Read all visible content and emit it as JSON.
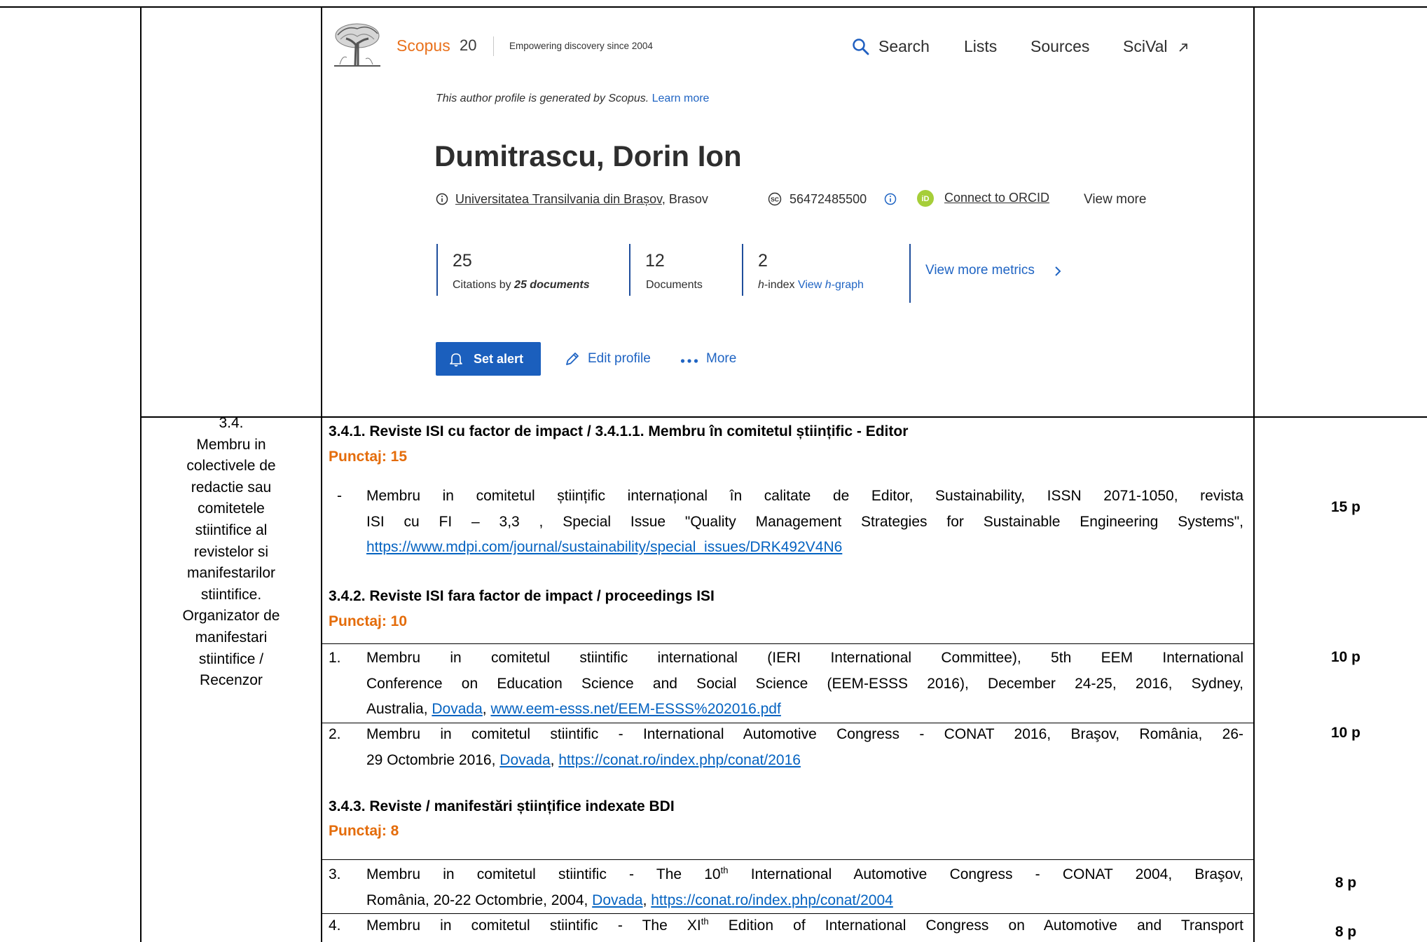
{
  "scopus": {
    "brand": "Scopus",
    "brand_number": "20",
    "tagline": "Empowering discovery since 2004",
    "nav": {
      "search": "Search",
      "lists": "Lists",
      "sources": "Sources",
      "scival": "SciVal"
    },
    "notice": {
      "text": "This author profile is generated by Scopus. ",
      "link": "Learn more"
    },
    "author": {
      "name": "Dumitrascu, Dorin Ion",
      "affiliation": "Universitatea Transilvania din Brașov",
      "city": ", Brasov",
      "author_id": "56472485500",
      "orcid": "Connect to ORCID",
      "view_more": "View more"
    },
    "metrics": {
      "citations": {
        "value": "25",
        "label": "Citations by ",
        "label_emph": "25 documents"
      },
      "documents": {
        "value": "12",
        "label": "Documents"
      },
      "h_index": {
        "value": "2",
        "label_h": "h",
        "label": "-index ",
        "link_prefix": "View ",
        "link_h": "h",
        "link_suffix": "-graph"
      },
      "view_more_metrics": "View more metrics"
    },
    "actions": {
      "set_alert": "Set alert",
      "edit_profile": "Edit profile",
      "more": "More"
    },
    "icons": {
      "logo": "elsevier-tree-logo",
      "search": "search-icon",
      "scival": "external-link-icon",
      "affiliation": "info-icon",
      "author_id_badge": "SC",
      "orcid_badge": "iD",
      "metrics": "chevron-right-icon",
      "set_alert": "bell-icon",
      "edit_profile": "pencil-icon",
      "more": "ellipsis-icon"
    },
    "colors": {
      "brand_orange": "#e9711c",
      "link_blue": "#1f64c3",
      "button_blue": "#1b5fbd",
      "orcid_green": "#a6ce39"
    }
  },
  "criterion": {
    "number": "3.4.",
    "lines": [
      "Membru in",
      "colectivele de",
      "redactie sau",
      "comitetele",
      "stiintifice al",
      "revistelor si",
      "manifestarilor",
      "stiintifice.",
      "Organizator de",
      "manifestari",
      "stiintifice /",
      "Recenzor"
    ]
  },
  "sections": [
    {
      "heading": "3.4.1. Reviste ISI cu factor de impact / 3.4.1.1. Membru în comitetul științific - Editor",
      "score": "Punctaj: 15",
      "items": [
        {
          "marker": "-",
          "lines": [
            [
              "Membru in comitetul științific internațional în calitate de Editor, Sustainability, ISSN 2071-1050, revista"
            ],
            [
              "ISI cu FI – 3,3 , Special Issue \"Quality Management Strategies for Sustainable Engineering Systems\","
            ],
            [
              "https://www.mdpi.com/journal/sustainability/special_issues/DRK492V4N6"
            ]
          ],
          "points": "15 p"
        }
      ]
    },
    {
      "heading": "3.4.2. Reviste ISI fara factor de impact / proceedings ISI",
      "score": "Punctaj: 10",
      "items": [
        {
          "marker": "1.",
          "lines": [
            [
              "Membru in comitetul stiintific international (IERI International Committee), 5th EEM International"
            ],
            [
              "Conference on Education Science and Social Science (EEM-ESSS 2016), December 24-25, 2016, Sydney,"
            ],
            [
              "Australia, ",
              "Dovada",
              ", ",
              "www.eem-esss.net/EEM-ESSS%202016.pdf"
            ]
          ],
          "points": "10 p"
        },
        {
          "marker": "2.",
          "lines": [
            [
              "Membru in comitetul stiintific - International Automotive Congress - CONAT 2016, Braşov, România, 26-"
            ],
            [
              "29 Octombrie 2016, ",
              "Dovada",
              ", ",
              "https://conat.ro/index.php/conat/2016"
            ]
          ],
          "points": "10 p"
        }
      ]
    },
    {
      "heading": "3.4.3. Reviste / manifestări științifice indexate BDI",
      "score": "Punctaj: 8",
      "items": [
        {
          "marker": "3.",
          "lines": [
            [
              "Membru in comitetul stiintific - The 10",
              "th",
              " International Automotive Congress - CONAT 2004, Braşov,"
            ],
            [
              "România, 20-22 Octombrie, 2004, ",
              "Dovada",
              ", ",
              "https://conat.ro/index.php/conat/2004"
            ]
          ],
          "points": "8 p"
        },
        {
          "marker": "4.",
          "lines": [
            [
              "Membru in comitetul stiintific - The XI",
              "th",
              " Edition of International Congress on Automotive and Transport"
            ]
          ],
          "points": "8 p"
        }
      ]
    }
  ]
}
